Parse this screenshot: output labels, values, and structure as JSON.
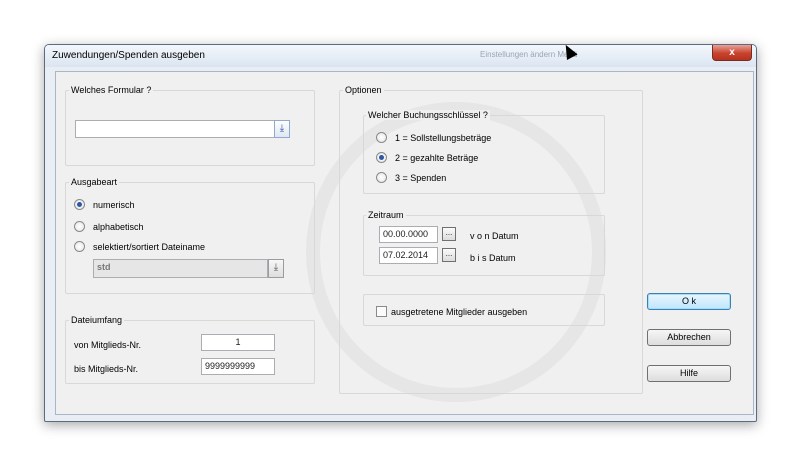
{
  "window": {
    "title": "Zuwendungen/Spenden ausgeben",
    "close_label": "x",
    "background_ghost_text": "Einstellungen ändern  Menü"
  },
  "formular": {
    "legend": "Welches Formular ?",
    "value": "",
    "dropdown_icon": "download-arrow-icon"
  },
  "ausgabeart": {
    "legend": "Ausgabeart",
    "options": [
      {
        "label": "numerisch",
        "selected": true
      },
      {
        "label": "alphabetisch",
        "selected": false
      },
      {
        "label": "selektiert/sortiert Dateiname",
        "selected": false
      }
    ],
    "dateiname_value": "std"
  },
  "dateiumfang": {
    "legend": "Dateiumfang",
    "von_label": "von Mitglieds-Nr.",
    "von_value": "1",
    "bis_label": "bis  Mitglieds-Nr.",
    "bis_value": "9999999999"
  },
  "optionen": {
    "legend": "Optionen",
    "buchung": {
      "legend": "Welcher Buchungsschlüssel ?",
      "options": [
        {
          "label": "1 = Sollstellungsbeträge",
          "selected": false
        },
        {
          "label": "2 = gezahlte Beträge",
          "selected": true
        },
        {
          "label": "3 = Spenden",
          "selected": false
        }
      ]
    },
    "zeitraum": {
      "legend": "Zeitraum",
      "von_value": "00.00.0000",
      "von_label": "v o n  Datum",
      "bis_value": "07.02.2014",
      "bis_label": "b i s   Datum",
      "picker_label": "..."
    },
    "checkbox_label": "ausgetretene Mitglieder ausgeben",
    "checkbox_checked": false
  },
  "buttons": {
    "ok": "O k",
    "cancel": "Abbrechen",
    "help": "Hilfe"
  }
}
